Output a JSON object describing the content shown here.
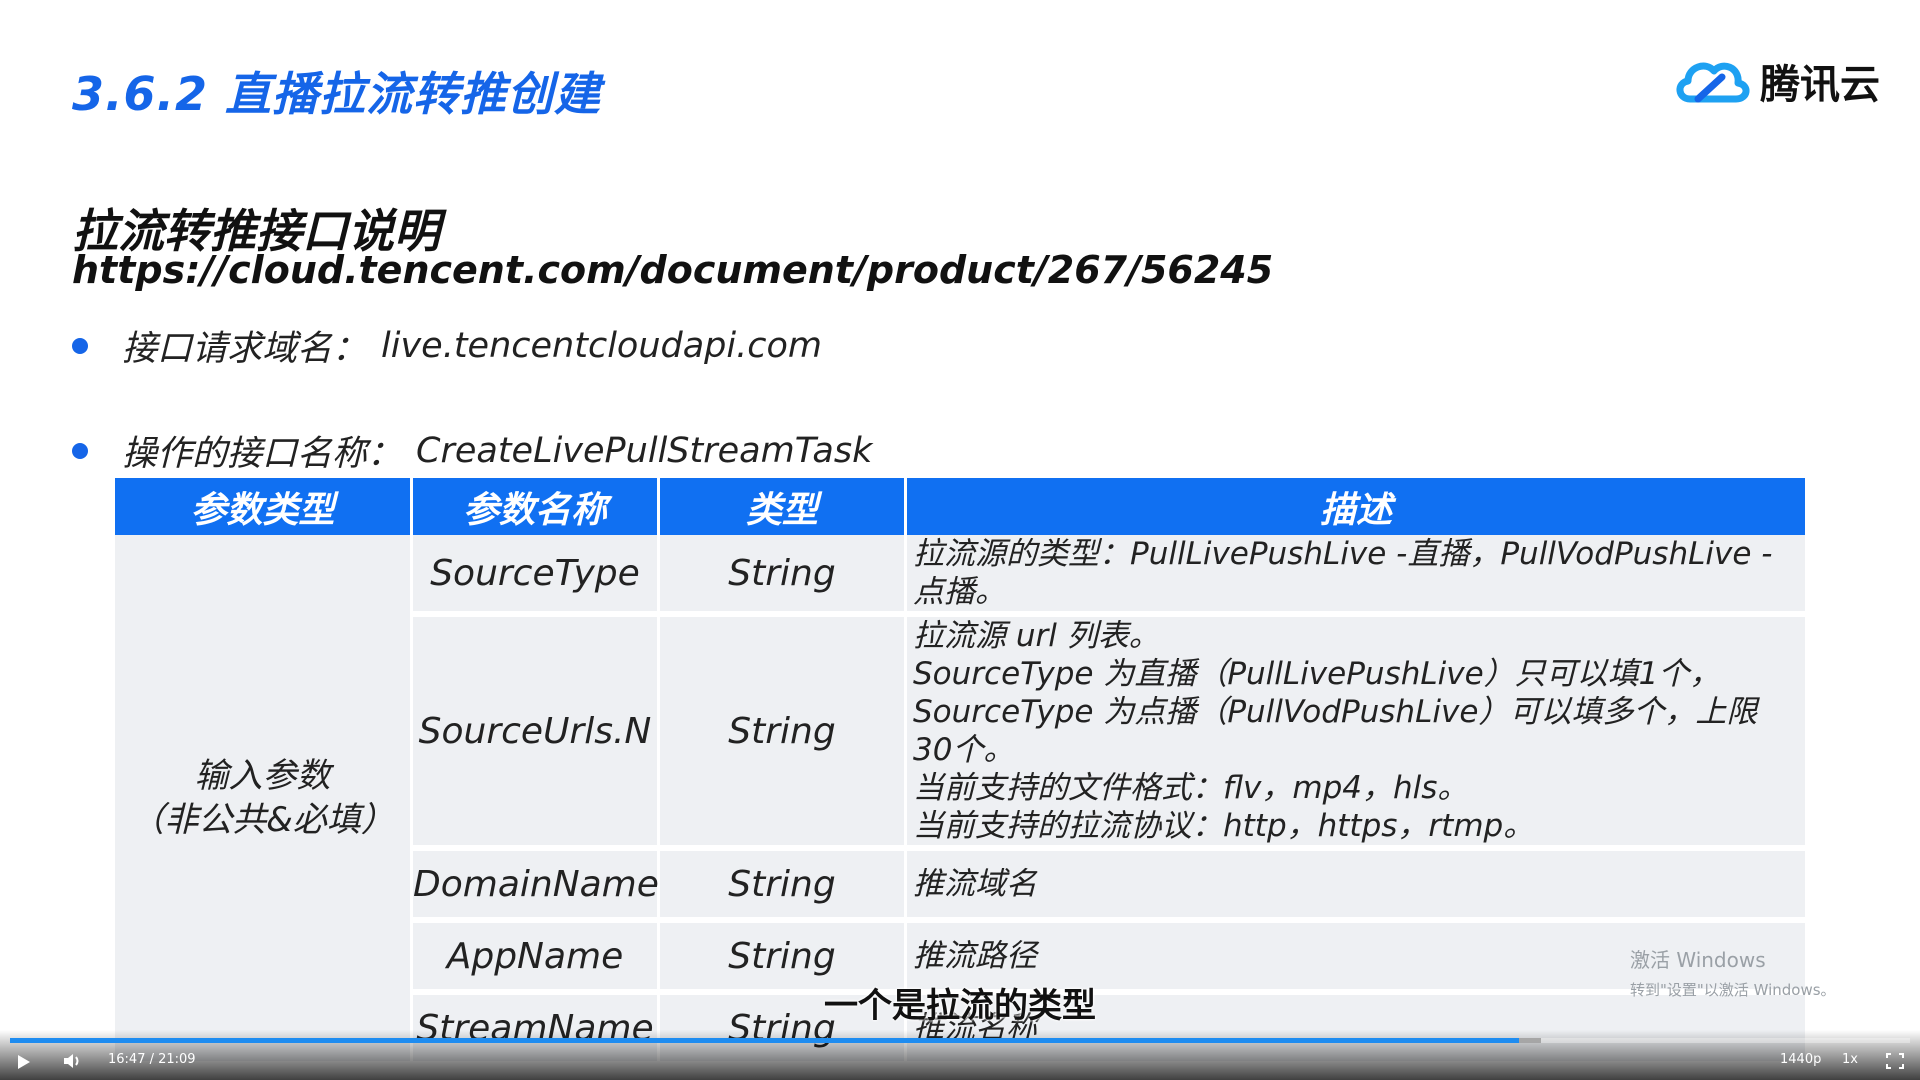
{
  "slide": {
    "title": "3.6.2 直播拉流转推创建",
    "logo_text": "腾讯云",
    "heading": "拉流转推接口说明",
    "url": "https://cloud.tencent.com/document/product/267/56245",
    "bullets": [
      {
        "label": "接口请求域名：",
        "value": "live.tencentcloudapi.com"
      },
      {
        "label": "操作的接口名称：",
        "value": "CreateLivePullStreamTask"
      }
    ]
  },
  "table": {
    "headers": [
      "参数类型",
      "参数名称",
      "类型",
      "描述"
    ],
    "group_label_line1": "输入参数",
    "group_label_line2": "（非公共&必填）",
    "rows": [
      {
        "name": "SourceType",
        "type": "String",
        "desc": [
          "拉流源的类型：PullLivePushLive -直播，PullVodPushLive -",
          "点播。"
        ]
      },
      {
        "name": "SourceUrls.N",
        "type": "String",
        "desc": [
          "拉流源 url 列表。",
          "SourceType 为直播（PullLivePushLive）只可以填1个，",
          "SourceType 为点播（PullVodPushLive）可以填多个，上限",
          "30个。",
          "当前支持的文件格式：flv，mp4，hls。",
          "当前支持的拉流协议：http，https，rtmp。"
        ]
      },
      {
        "name": "DomainName",
        "type": "String",
        "desc": [
          "推流域名"
        ]
      },
      {
        "name": "AppName",
        "type": "String",
        "desc": [
          "推流路径"
        ]
      },
      {
        "name": "StreamName",
        "type": "String",
        "desc": [
          "推流名称"
        ]
      }
    ]
  },
  "watermark": {
    "line1": "激活 Windows",
    "line2": "转到\"设置\"以激活 Windows。"
  },
  "subtitle": "一个是拉流的类型",
  "player": {
    "time": "16:47 / 21:09",
    "progress": 0.794,
    "buffered": 0.806,
    "quality": "1440p",
    "speed": "1x"
  },
  "colors": {
    "accent": "#1070f2",
    "title": "#1565e8",
    "cell_bg": "#eef0f3"
  }
}
